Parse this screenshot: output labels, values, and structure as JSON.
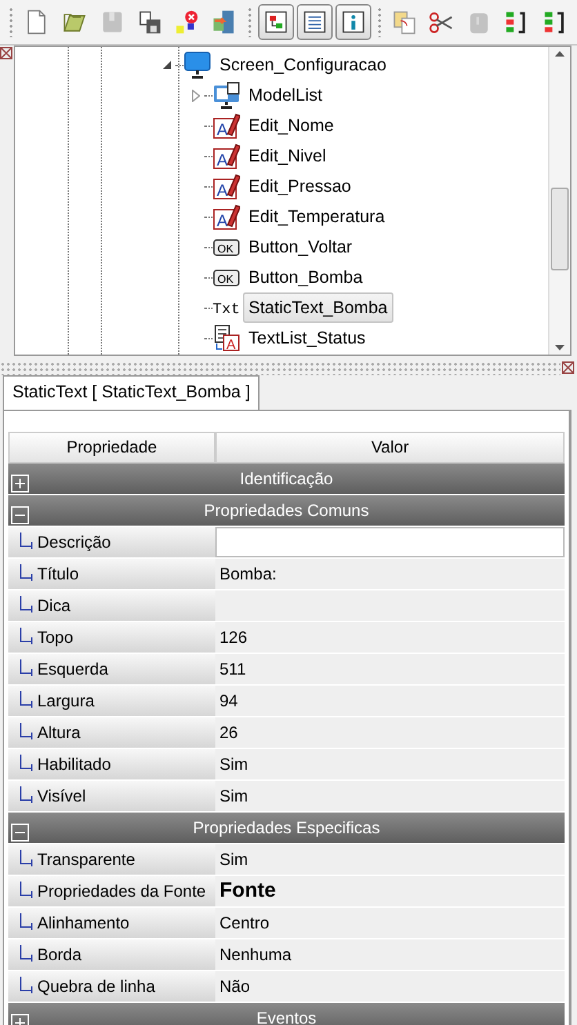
{
  "toolbar": {
    "groups": [
      [
        {
          "kind": "new",
          "disabled": false,
          "pressed": false
        },
        {
          "kind": "open",
          "disabled": false,
          "pressed": false
        },
        {
          "kind": "save",
          "disabled": true,
          "pressed": false
        },
        {
          "kind": "print",
          "disabled": false,
          "pressed": false
        },
        {
          "kind": "delete",
          "disabled": false,
          "pressed": false
        },
        {
          "kind": "exit",
          "disabled": false,
          "pressed": false
        }
      ],
      [
        {
          "kind": "tree",
          "disabled": false,
          "pressed": true
        },
        {
          "kind": "list",
          "disabled": false,
          "pressed": true
        },
        {
          "kind": "info",
          "disabled": false,
          "pressed": true
        }
      ],
      [
        {
          "kind": "copy",
          "disabled": false,
          "pressed": false
        },
        {
          "kind": "cut",
          "disabled": false,
          "pressed": false
        },
        {
          "kind": "paste",
          "disabled": true,
          "pressed": false
        },
        {
          "kind": "up",
          "disabled": false,
          "pressed": false
        },
        {
          "kind": "down",
          "disabled": false,
          "pressed": false
        }
      ]
    ]
  },
  "tree": {
    "items": [
      {
        "label": "Screen_Configuracao",
        "kind": "screen",
        "expanded": true,
        "selected": false,
        "children": [
          {
            "label": "ModelList",
            "kind": "modellist",
            "expanded": false,
            "selected": false
          },
          {
            "label": "Edit_Nome",
            "kind": "edit",
            "icon_text": "A",
            "selected": false
          },
          {
            "label": "Edit_Nivel",
            "kind": "edit",
            "icon_text": "A",
            "selected": false
          },
          {
            "label": "Edit_Pressao",
            "kind": "edit",
            "icon_text": "A",
            "selected": false
          },
          {
            "label": "Edit_Temperatura",
            "kind": "edit",
            "icon_text": "A",
            "selected": false
          },
          {
            "label": "Button_Voltar",
            "kind": "button",
            "icon_text": "OK",
            "selected": false
          },
          {
            "label": "Button_Bomba",
            "kind": "button",
            "icon_text": "OK",
            "selected": false
          },
          {
            "label": "StaticText_Bomba",
            "kind": "text",
            "icon_text": "Txt",
            "selected": true
          },
          {
            "label": "TextList_Status",
            "kind": "textlist",
            "icon_text": "A",
            "selected": false
          }
        ]
      }
    ]
  },
  "properties": {
    "tab": "StaticText [ StaticText_Bomba ]",
    "columns": [
      "Propriedade",
      "Valor"
    ],
    "sections": [
      {
        "title": "Identificação",
        "expanded": false
      },
      {
        "title": "Propriedades Comuns",
        "expanded": true,
        "rows": [
          {
            "name": "Descrição",
            "editing": true
          },
          {
            "name": "Título",
            "value": "Bomba:",
            "editing": false
          },
          {
            "name": "Dica",
            "editing": false
          },
          {
            "name": "Topo",
            "value": "126",
            "editing": false
          },
          {
            "name": "Esquerda",
            "value": "511",
            "editing": false
          },
          {
            "name": "Largura",
            "value": "94",
            "editing": false
          },
          {
            "name": "Altura",
            "value": "26",
            "editing": false
          },
          {
            "name": "Habilitado",
            "value": "Sim",
            "editing": false
          },
          {
            "name": "Visível",
            "value": "Sim",
            "editing": false
          }
        ]
      },
      {
        "title": "Propriedades Especificas",
        "expanded": true,
        "rows": [
          {
            "name": "Transparente",
            "value": "Sim",
            "editing": false
          },
          {
            "name": "Propriedades da Fonte",
            "value": "Fonte",
            "kind": "font",
            "editing": false
          },
          {
            "name": "Alinhamento",
            "value": "Centro",
            "editing": false
          },
          {
            "name": "Borda",
            "value": "Nenhuma",
            "editing": false
          },
          {
            "name": "Quebra de linha",
            "value": "Não",
            "editing": false
          }
        ]
      },
      {
        "title": "Eventos",
        "expanded": false
      }
    ]
  }
}
